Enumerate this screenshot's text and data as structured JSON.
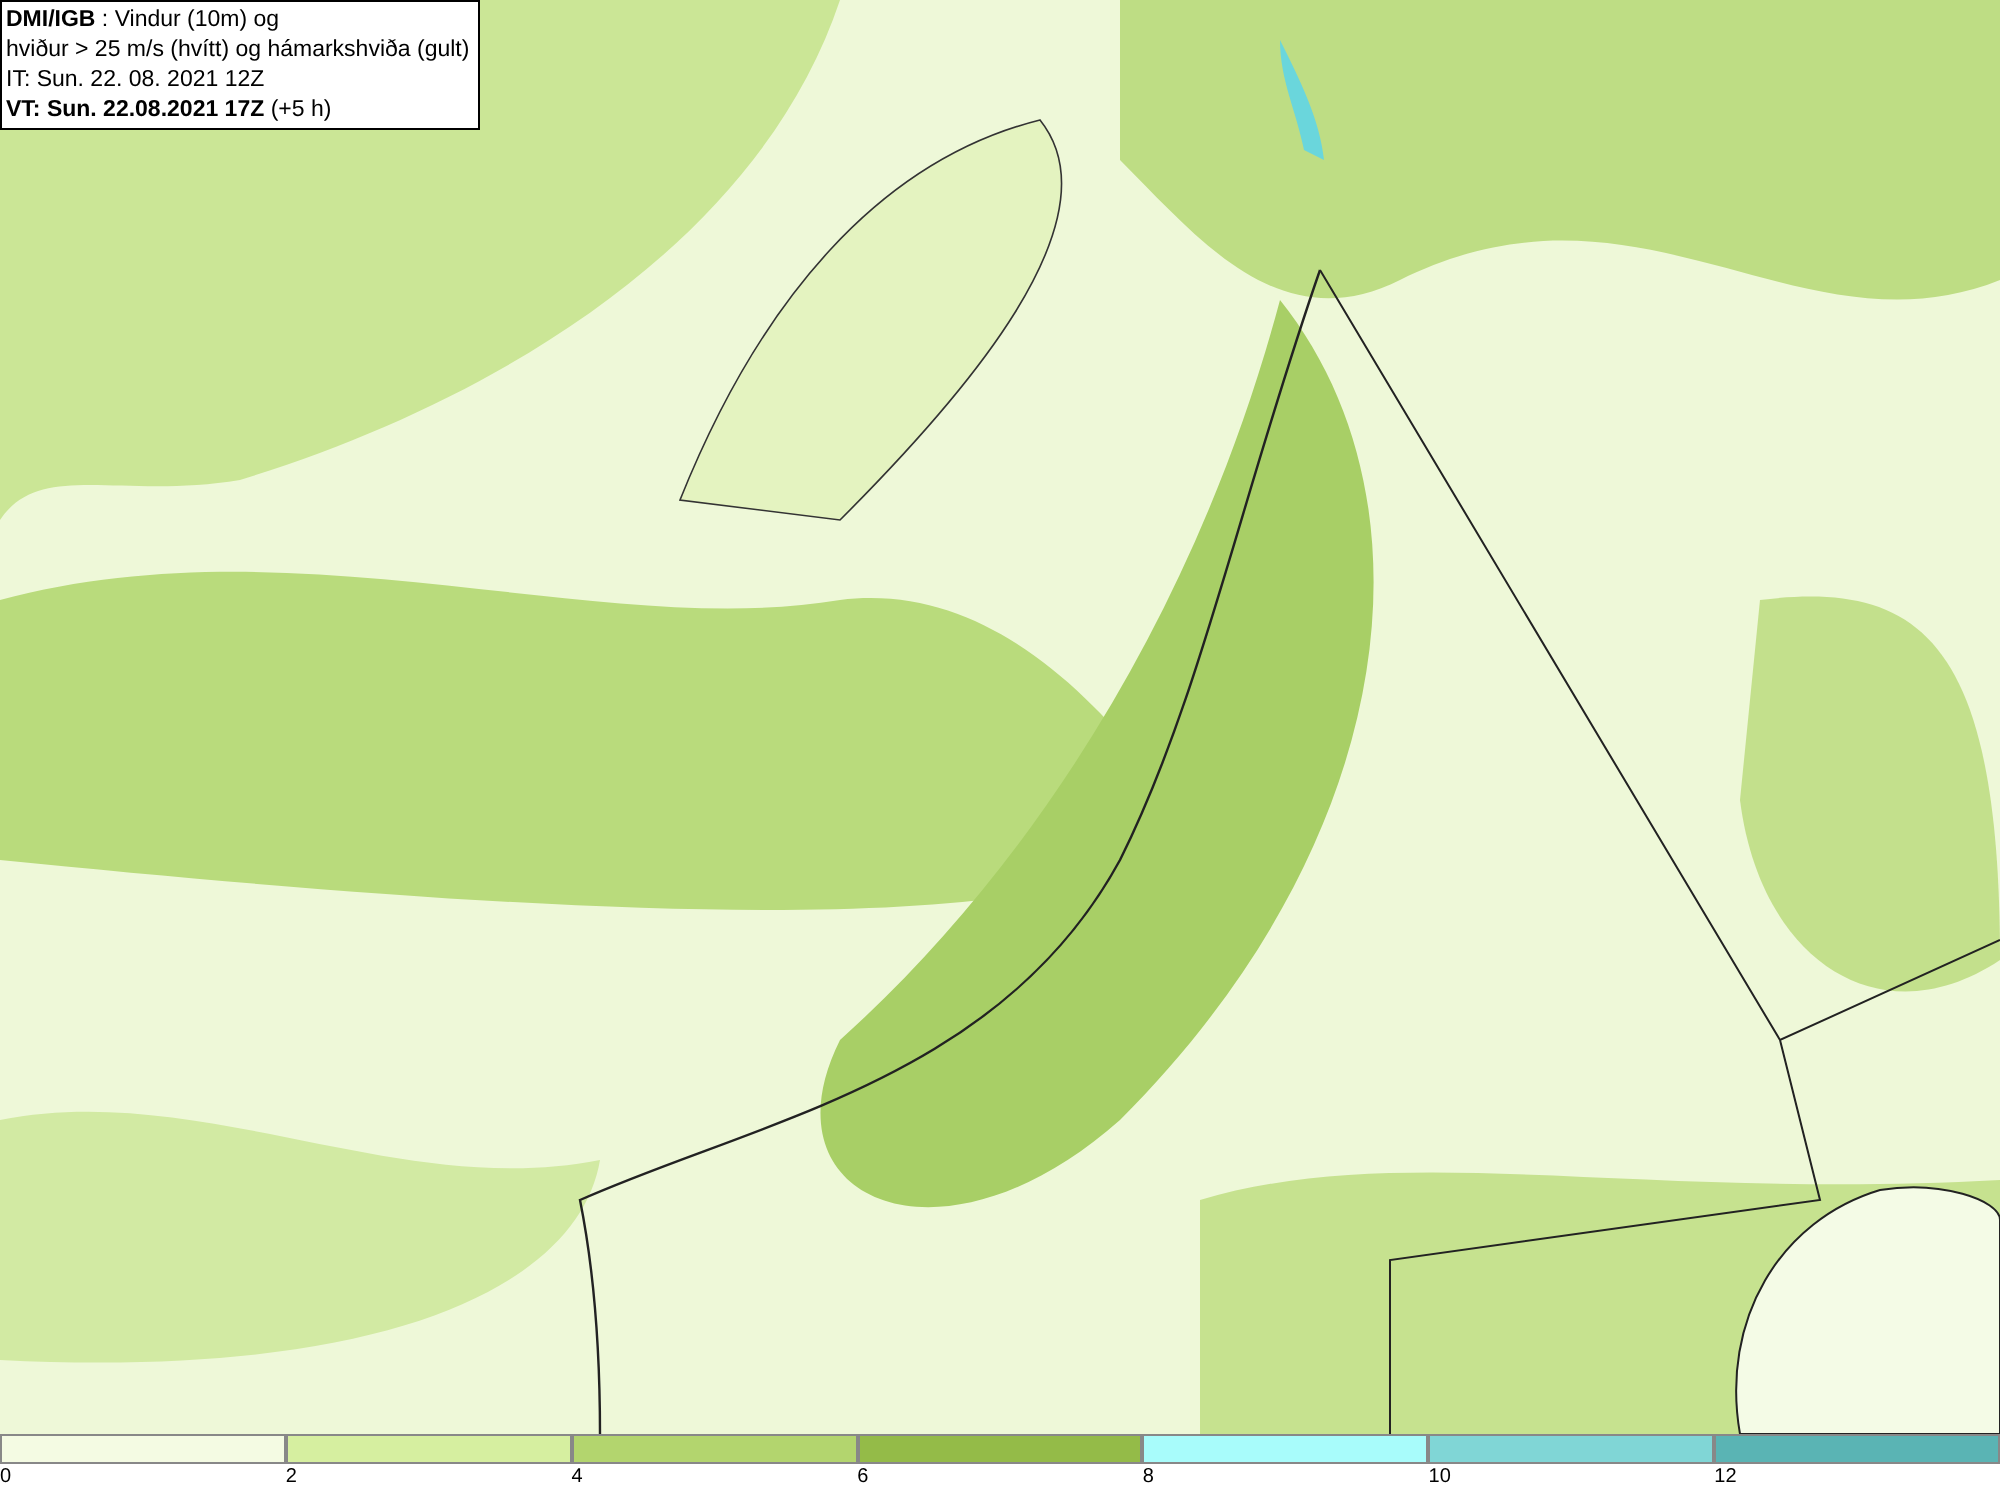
{
  "header": {
    "lines": [
      "**DMI/IGB** : Vindur (10m) og",
      "hviður > 25 m/s (hvítt) og hámarkshviða (gult)",
      "IT: Sun. 22. 08. 2021 12Z",
      "**VT: Sun. 22.08.2021 17Z** (+5 h)"
    ]
  },
  "legend": [
    {
      "label": "0",
      "color": "#f4fbe3"
    },
    {
      "label": "2",
      "color": "#d6efa0"
    },
    {
      "label": "4",
      "color": "#b3d56e"
    },
    {
      "label": "6",
      "color": "#94bb48"
    },
    {
      "label": "8",
      "color": "#a8fcfb"
    },
    {
      "label": "10",
      "color": "#80d6d6"
    },
    {
      "label": "12",
      "color": "#5ab4b4"
    }
  ]
}
